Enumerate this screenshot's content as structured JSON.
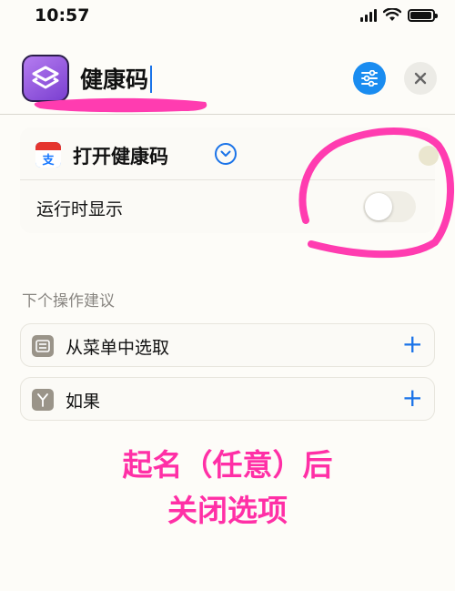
{
  "status": {
    "time": "10:57"
  },
  "header": {
    "title": "健康码"
  },
  "action": {
    "label": "打开健康码",
    "icon_text": "支"
  },
  "toggle": {
    "label": "运行时显示",
    "state": "off"
  },
  "suggestions": {
    "title": "下个操作建议",
    "items": [
      {
        "label": "从菜单中选取",
        "icon": "menu-icon"
      },
      {
        "label": "如果",
        "icon": "branch-icon"
      }
    ]
  },
  "annotation": {
    "line1": "起名（任意）后",
    "line2": "关闭选项"
  },
  "colors": {
    "accent": "#1a73e8",
    "annotation": "#ff2fa6",
    "shortcut_purple": "#8a4de0"
  }
}
